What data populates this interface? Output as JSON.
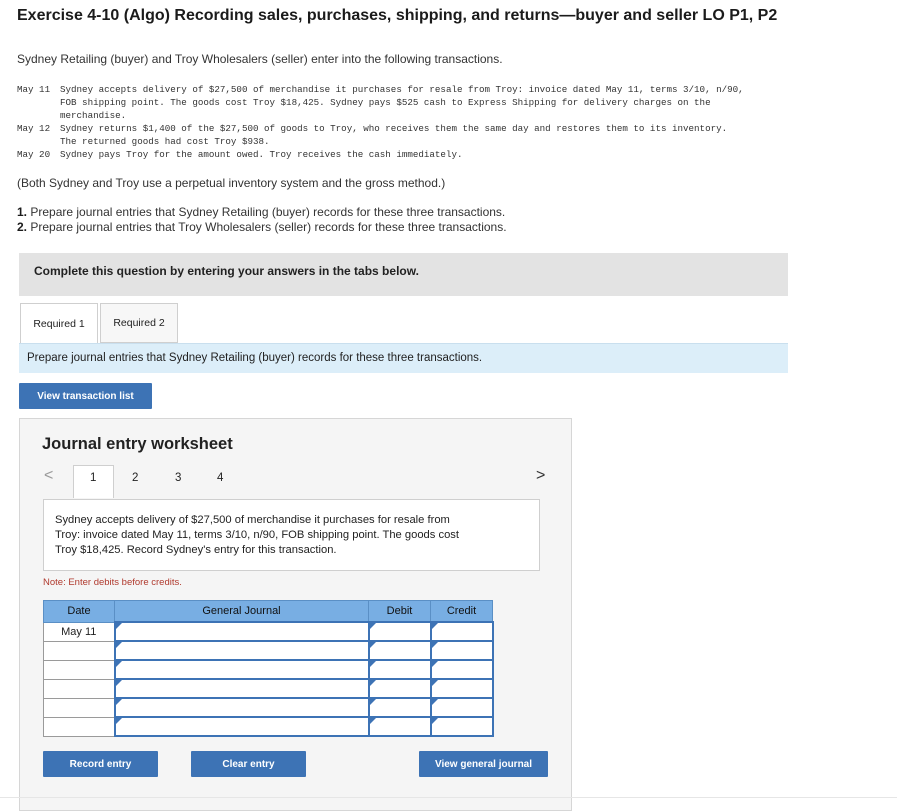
{
  "title": "Exercise 4-10 (Algo) Recording sales, purchases, shipping, and returns—buyer and seller LO P1, P2",
  "intro": "Sydney Retailing (buyer) and Troy Wholesalers (seller) enter into the following transactions.",
  "transactions": [
    {
      "date": "May 11",
      "lines": [
        "Sydney accepts delivery of $27,500 of merchandise it purchases for resale from Troy: invoice dated May 11, terms 3/10, n/90,",
        "FOB shipping point. The goods cost Troy $18,425. Sydney pays $525 cash to Express Shipping for delivery charges on the",
        "merchandise."
      ]
    },
    {
      "date": "May 12",
      "lines": [
        "Sydney returns $1,400 of the $27,500 of goods to Troy, who receives them the same day and restores them to its inventory.",
        "The returned goods had cost Troy $938."
      ]
    },
    {
      "date": "May 20",
      "lines": [
        "Sydney pays Troy for the amount owed. Troy receives the cash immediately."
      ]
    }
  ],
  "system_note": "(Both Sydney and Troy use a perpetual inventory system and the gross method.)",
  "requirements": [
    {
      "num": "1.",
      "text": "Prepare journal entries that Sydney Retailing (buyer) records for these three transactions."
    },
    {
      "num": "2.",
      "text": "Prepare journal entries that Troy Wholesalers (seller) records for these three transactions."
    }
  ],
  "banner": "Complete this question by entering your answers in the tabs below.",
  "tabs": [
    "Required 1",
    "Required 2"
  ],
  "req_prompt": "Prepare journal entries that Sydney Retailing (buyer) records for these three transactions.",
  "view_transaction_list": "View transaction list",
  "worksheet": {
    "title": "Journal entry worksheet",
    "prev_arrow": "<",
    "next_arrow": ">",
    "pages": [
      "1",
      "2",
      "3",
      "4"
    ],
    "description": "Sydney accepts delivery of $27,500 of merchandise it purchases for resale from Troy: invoice dated May 11, terms 3/10, n/90, FOB shipping point. The goods cost Troy $18,425. Record Sydney's entry for this transaction.",
    "enter_note": "Note: Enter debits before credits.",
    "columns": [
      "Date",
      "General Journal",
      "Debit",
      "Credit"
    ],
    "rows": [
      {
        "date": "May 11"
      },
      {
        "date": ""
      },
      {
        "date": ""
      },
      {
        "date": ""
      },
      {
        "date": ""
      },
      {
        "date": ""
      }
    ],
    "buttons": {
      "record": "Record entry",
      "clear": "Clear entry",
      "view_journal": "View general journal"
    }
  }
}
